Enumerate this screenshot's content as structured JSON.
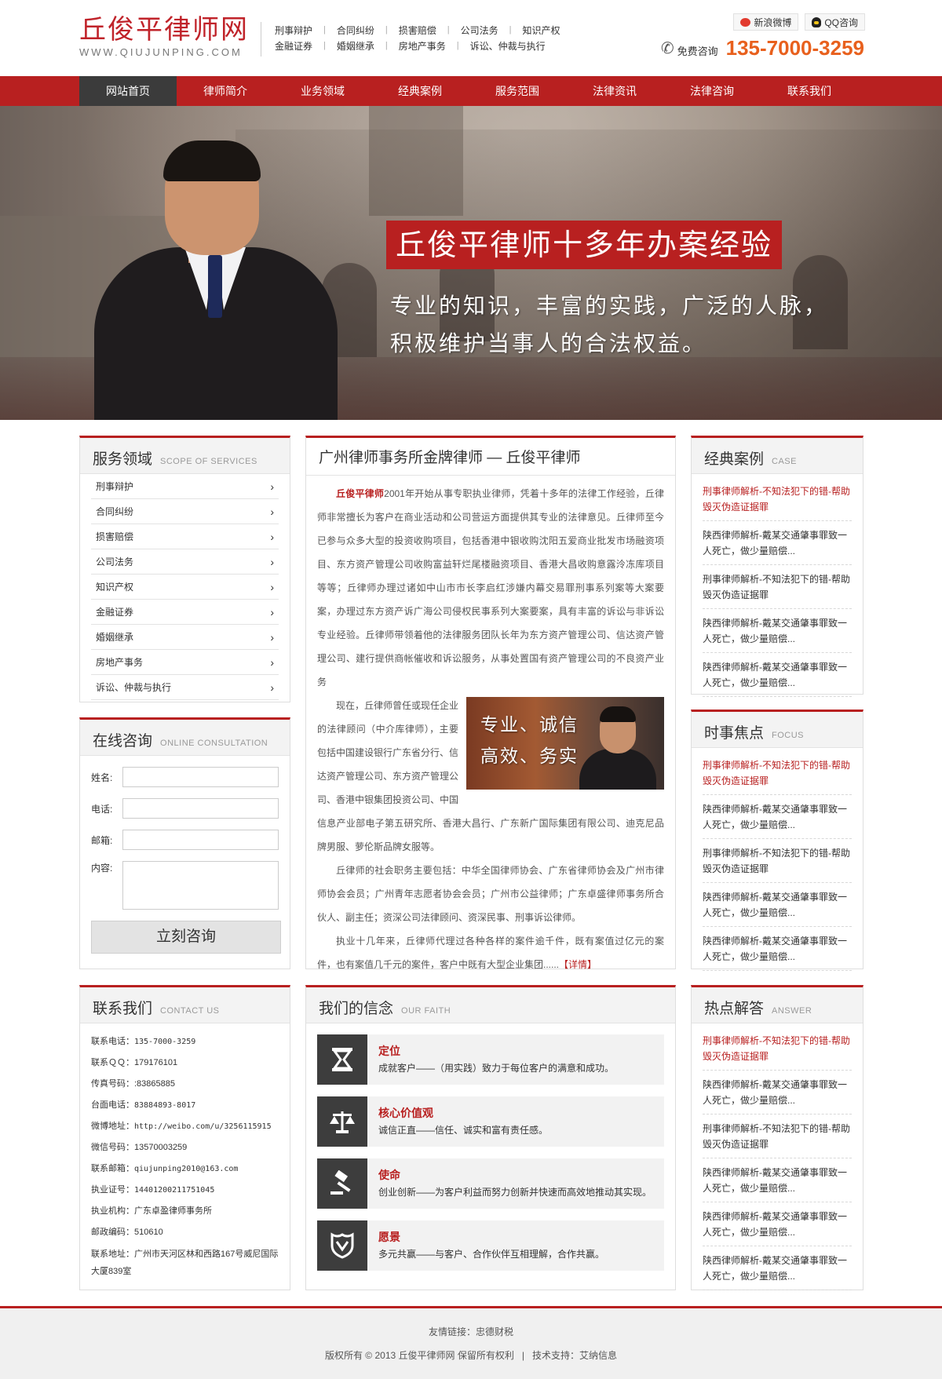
{
  "header": {
    "logo_cn": "丘俊平律师网",
    "logo_en": "WWW.QIUJUNPING.COM",
    "top_links_row1": [
      "刑事辩护",
      "合同纠纷",
      "损害赔偿",
      "公司法务",
      "知识产权"
    ],
    "top_links_row2": [
      "金融证券",
      "婚姻继承",
      "房地产事务",
      "诉讼、仲裁与执行"
    ],
    "weibo_label": "新浪微博",
    "qq_label": "QQ咨询",
    "hotline_label": "免费咨询",
    "hotline_number": "135-7000-3259"
  },
  "nav": {
    "items": [
      "网站首页",
      "律师简介",
      "业务领域",
      "经典案例",
      "服务范围",
      "法律资讯",
      "法律咨询",
      "联系我们"
    ],
    "active_index": 0
  },
  "banner": {
    "title": "丘俊平律师十多年办案经验",
    "sub_line1": "专业的知识，丰富的实践，广泛的人脉，",
    "sub_line2": "积极维护当事人的合法权益。"
  },
  "services": {
    "title_cn": "服务领域",
    "title_en": "SCOPE OF SERVICES",
    "items": [
      "刑事辩护",
      "合同纠纷",
      "损害赔偿",
      "公司法务",
      "知识产权",
      "金融证券",
      "婚姻继承",
      "房地产事务",
      "诉讼、仲裁与执行"
    ]
  },
  "consult": {
    "title_cn": "在线咨询",
    "title_en": "ONLINE CONSULTATION",
    "name_label": "姓名:",
    "phone_label": "电话:",
    "email_label": "邮箱:",
    "content_label": "内容:",
    "submit_label": "立刻咨询"
  },
  "contact": {
    "title_cn": "联系我们",
    "title_en": "CONTACT US",
    "lines": [
      {
        "label": "联系电话：",
        "value": "135-7000-3259"
      },
      {
        "label": "联系ＱＱ：",
        "value": "179176101"
      },
      {
        "label": "传真号码：",
        "value": ":83865885"
      },
      {
        "label": "台面电话：",
        "value": "83884893-8017"
      },
      {
        "label": "微博地址：",
        "value": "http://weibo.com/u/3256115915"
      },
      {
        "label": "微信号码：",
        "value": "13570003259"
      },
      {
        "label": "联系邮箱：",
        "value": "qiujunping2010@163.com"
      },
      {
        "label": "执业证号：",
        "value": "14401200211751045"
      },
      {
        "label": "执业机构：",
        "value": "广东卓盈律师事务所"
      },
      {
        "label": "邮政编码：",
        "value": "510610"
      },
      {
        "label": "联系地址：",
        "value": "广州市天河区林和西路167号威尼国际大厦839室"
      }
    ]
  },
  "intro": {
    "title": "广州律师事务所金牌律师 — 丘俊平律师",
    "name_hl": "丘俊平律师",
    "p1": "2001年开始从事专职执业律师，凭着十多年的法律工作经验，丘律师非常擅长为客户在商业活动和公司营运方面提供其专业的法律意见。丘律师至今已参与众多大型的投资收购项目，包括香港中银收购沈阳五爱商业批发市场融资项目、东方资产管理公司收购富益轩烂尾楼融资项目、香港大昌收购意露泠冻库项目等等；丘律师办理过诸如中山市市长李启红涉嫌内幕交易罪刑事系列案等大案要案，办理过东方资产诉广海公司侵权民事系列大案要案，具有丰富的诉讼与非诉讼专业经验。丘律师带领着他的法律服务团队长年为东方资产管理公司、信达资产管理公司、建行提供商帐催收和诉讼服务，从事处置国有资产管理公司的不良资产业务",
    "p2": "现在，丘律师曾任或现任企业的法律顾问（中介库律师），主要包括中国建设银行广东省分行、信达资产管理公司、东方资产管理公司、香港中银集团投资公司、中国信息产业部电子第五研究所、香港大昌行、广东新广国际集团有限公司、迪克尼品牌男服、萝伦斯品牌女服等。",
    "p3": "丘律师的社会职务主要包括：中华全国律师协会、广东省律师协会及广州市律师协会会员；广州青年志愿者协会会员；广州市公益律师；广东卓盛律师事务所合伙人、副主任；资深公司法律顾问、资深民事、刑事诉讼律师。",
    "p4": "执业十几年来，丘律师代理过各种各样的案件逾千件，既有案值过亿元的案件，也有案值几千元的案件，客户中既有大型企业集团......",
    "more_label": "【详情】",
    "img_line1": "专业、诚信",
    "img_line2": "高效、务实"
  },
  "faith": {
    "title_cn": "我们的信念",
    "title_en": "OUR FAITH",
    "items": [
      {
        "icon": "hourglass-icon",
        "title": "定位",
        "desc": "成就客户——（用实践）致力于每位客户的满意和成功。"
      },
      {
        "icon": "scales-icon",
        "title": "核心价值观",
        "desc": "诚信正直——信任、诚实和富有责任感。"
      },
      {
        "icon": "gavel-icon",
        "title": "使命",
        "desc": "创业创新——为客户利益而努力创新并快速而高效地推动其实现。"
      },
      {
        "icon": "shield-icon",
        "title": "愿景",
        "desc": "多元共赢——与客户、合作伙伴互相理解，合作共赢。"
      }
    ]
  },
  "cases": {
    "title_cn": "经典案例",
    "title_en": "CASE",
    "items": [
      {
        "text": "刑事律师解析-不知法犯下的错-帮助毁灭伪造证据罪",
        "red": true
      },
      {
        "text": "陕西律师解析-戴某交通肇事罪致一人死亡，做少量赔偿...",
        "red": false
      },
      {
        "text": "刑事律师解析-不知法犯下的错-帮助毁灭伪造证据罪",
        "red": false
      },
      {
        "text": "陕西律师解析-戴某交通肇事罪致一人死亡，做少量赔偿...",
        "red": false
      },
      {
        "text": "陕西律师解析-戴某交通肇事罪致一人死亡，做少量赔偿...",
        "red": false
      }
    ]
  },
  "focus": {
    "title_cn": "时事焦点",
    "title_en": "FOCUS",
    "items": [
      {
        "text": "刑事律师解析-不知法犯下的错-帮助毁灭伪造证据罪",
        "red": true
      },
      {
        "text": "陕西律师解析-戴某交通肇事罪致一人死亡，做少量赔偿...",
        "red": false
      },
      {
        "text": "刑事律师解析-不知法犯下的错-帮助毁灭伪造证据罪",
        "red": false
      },
      {
        "text": "陕西律师解析-戴某交通肇事罪致一人死亡，做少量赔偿...",
        "red": false
      },
      {
        "text": "陕西律师解析-戴某交通肇事罪致一人死亡，做少量赔偿...",
        "red": false
      }
    ]
  },
  "answers": {
    "title_cn": "热点解答",
    "title_en": "ANSWER",
    "items": [
      {
        "text": "刑事律师解析-不知法犯下的错-帮助毁灭伪造证据罪",
        "red": true
      },
      {
        "text": "陕西律师解析-戴某交通肇事罪致一人死亡，做少量赔偿...",
        "red": false
      },
      {
        "text": "刑事律师解析-不知法犯下的错-帮助毁灭伪造证据罪",
        "red": false
      },
      {
        "text": "陕西律师解析-戴某交通肇事罪致一人死亡，做少量赔偿...",
        "red": false
      },
      {
        "text": "陕西律师解析-戴某交通肇事罪致一人死亡，做少量赔偿...",
        "red": false
      },
      {
        "text": "陕西律师解析-戴某交通肇事罪致一人死亡，做少量赔偿...",
        "red": false
      }
    ]
  },
  "footer": {
    "links_label": "友情链接：",
    "links": [
      "忠德财税"
    ],
    "copyright": "版权所有 © 2013 丘俊平律师网 保留所有权利",
    "sep": "|",
    "tech_label": "技术支持：",
    "tech_value": "艾纳信息"
  },
  "colors": {
    "brand_red": "#b82020",
    "hotline_orange": "#e8601d",
    "nav_active": "#3b3b3b"
  }
}
